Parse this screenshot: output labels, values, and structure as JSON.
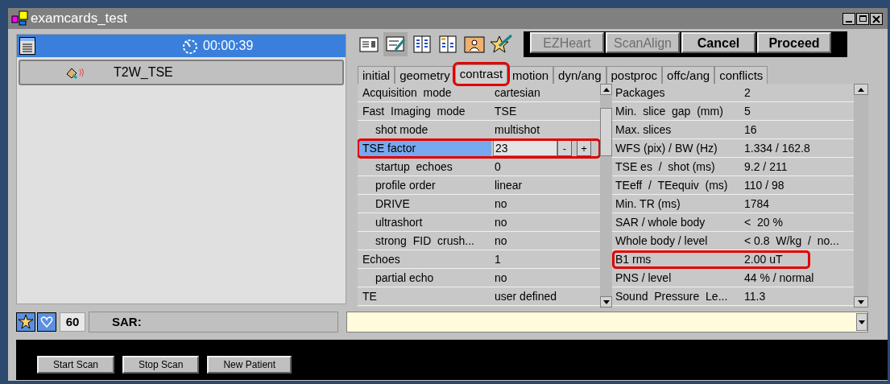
{
  "window": {
    "title": "examcards_test"
  },
  "left_panel": {
    "timer": "00:00:39",
    "scan_item": {
      "name": "T2W_TSE"
    }
  },
  "toolbar": {
    "buttons": [
      {
        "label": "EZHeart",
        "disabled": true
      },
      {
        "label": "ScanAlign",
        "disabled": true
      },
      {
        "label": "Cancel",
        "disabled": false
      },
      {
        "label": "Proceed",
        "disabled": false
      }
    ]
  },
  "tabs": [
    {
      "label": "initial",
      "selected": false,
      "highlighted": false
    },
    {
      "label": "geometry",
      "selected": false,
      "highlighted": false
    },
    {
      "label": "contrast",
      "selected": true,
      "highlighted": true
    },
    {
      "label": "motion",
      "selected": false,
      "highlighted": false
    },
    {
      "label": "dyn/ang",
      "selected": false,
      "highlighted": false
    },
    {
      "label": "postproc",
      "selected": false,
      "highlighted": false
    },
    {
      "label": "offc/ang",
      "selected": false,
      "highlighted": false
    },
    {
      "label": "conflicts",
      "selected": false,
      "highlighted": false
    }
  ],
  "parameters": [
    {
      "label": "Acquisition  mode",
      "value": "cartesian",
      "kind": "text",
      "selected": false,
      "highlighted": false
    },
    {
      "label": "Fast  Imaging  mode",
      "value": "TSE",
      "kind": "text",
      "selected": false,
      "highlighted": false,
      "children": [
        {
          "label": "shot mode",
          "value": "multishot",
          "kind": "text",
          "selected": false,
          "highlighted": false
        }
      ]
    },
    {
      "label": "TSE factor",
      "value": "23",
      "kind": "spinner",
      "minus": "-",
      "plus": "+",
      "selected": true,
      "highlighted": true,
      "children": [
        {
          "label": "startup  echoes",
          "value": "0",
          "kind": "text",
          "selected": false,
          "highlighted": false
        },
        {
          "label": "profile order",
          "value": "linear",
          "kind": "text",
          "selected": false,
          "highlighted": false
        },
        {
          "label": "DRIVE",
          "value": "no",
          "kind": "text",
          "selected": false,
          "highlighted": false
        },
        {
          "label": "ultrashort",
          "value": "no",
          "kind": "text",
          "selected": false,
          "highlighted": false
        },
        {
          "label": "strong  FID  crush...",
          "value": "no",
          "kind": "text",
          "selected": false,
          "highlighted": false
        }
      ]
    },
    {
      "label": "Echoes",
      "value": "1",
      "kind": "text",
      "selected": false,
      "highlighted": false,
      "children": [
        {
          "label": "partial echo",
          "value": "no",
          "kind": "text",
          "selected": false,
          "highlighted": false
        }
      ]
    },
    {
      "label": "TE",
      "value": "user defined",
      "kind": "text",
      "selected": false,
      "highlighted": false
    }
  ],
  "info": [
    {
      "label": "Packages",
      "value": "2",
      "highlighted": false
    },
    {
      "label": "Min.  slice  gap  (mm)",
      "value": "5",
      "highlighted": false
    },
    {
      "label": "Max. slices",
      "value": "16",
      "highlighted": false
    },
    {
      "label": "WFS (pix) / BW (Hz)",
      "value": "1.334 / 162.8",
      "highlighted": false
    },
    {
      "label": "TSE es  /  shot (ms)",
      "value": "9.2 / 211",
      "highlighted": false
    },
    {
      "label": "TEeff  /  TEequiv  (ms)",
      "value": "110 / 98",
      "highlighted": false
    },
    {
      "label": "Min. TR (ms)",
      "value": "1784",
      "highlighted": false
    },
    {
      "label": "SAR / whole body",
      "value": "<  20 %",
      "highlighted": false
    },
    {
      "label": "Whole body / level",
      "value": "< 0.8  W/kg  /  no...",
      "highlighted": false
    },
    {
      "label": "B1 rms",
      "value": "2.00 uT",
      "highlighted": true
    },
    {
      "label": "PNS / level",
      "value": "44 % / normal",
      "highlighted": false
    },
    {
      "label": "Sound  Pressure  Le...",
      "value": "11.3",
      "highlighted": false
    }
  ],
  "status": {
    "count": "60",
    "sar_label": "SAR:"
  },
  "bottom_buttons": [
    "Start Scan",
    "Stop Scan",
    "New Patient"
  ]
}
